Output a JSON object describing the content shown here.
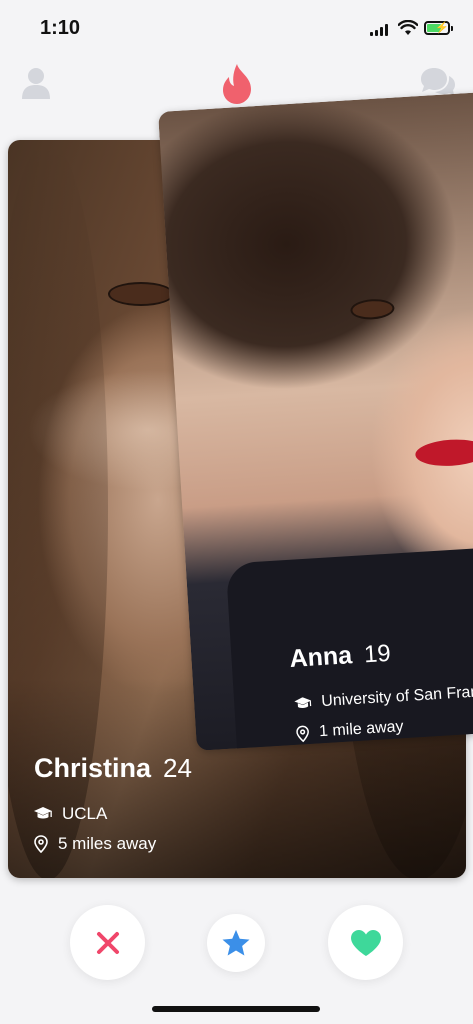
{
  "status_bar": {
    "time": "1:10"
  },
  "nav": {
    "left_icon": "profile-icon",
    "center_icon": "flame-icon",
    "right_icon": "chat-icon",
    "accent_color": "#f0616d"
  },
  "cards": [
    {
      "name": "Anna",
      "age": "19",
      "school": "University of San Francisco",
      "distance": "1 mile away",
      "position": "front"
    },
    {
      "name": "Christina",
      "age": "24",
      "school": "UCLA",
      "distance": "5 miles away",
      "position": "back"
    }
  ],
  "actions": {
    "nope_icon": "close-icon",
    "superlike_icon": "star-icon",
    "like_icon": "heart-icon",
    "nope_color": "#f0466a",
    "superlike_color": "#3b8fe8",
    "like_color": "#3ed89a"
  }
}
